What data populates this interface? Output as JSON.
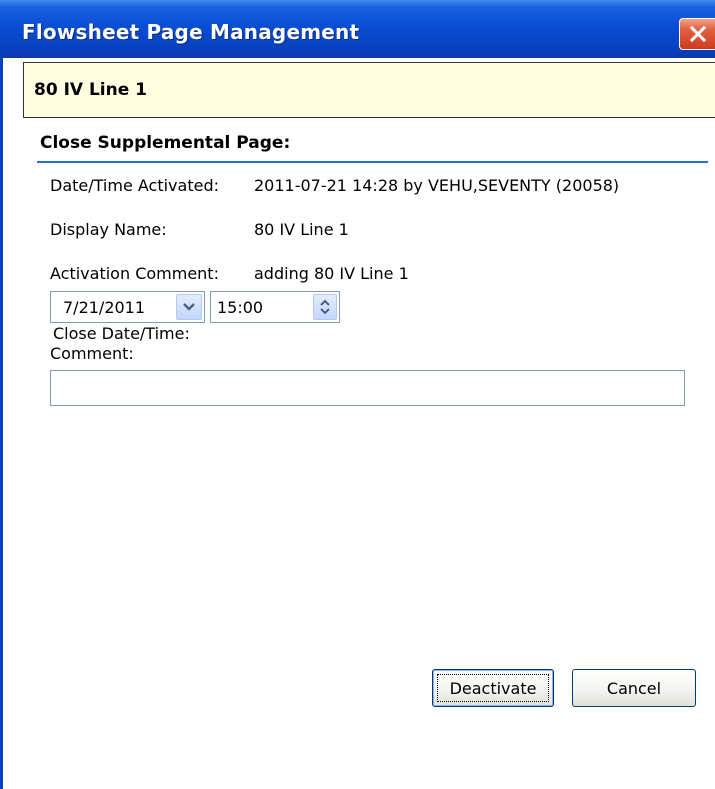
{
  "window": {
    "title": "Flowsheet Page Management"
  },
  "page_header": "80 IV Line 1",
  "section": {
    "title": "Close Supplemental Page:"
  },
  "fields": {
    "date_time_activated": {
      "label": "Date/Time Activated:",
      "value": "2011-07-21 14:28 by VEHU,SEVENTY (20058)"
    },
    "display_name": {
      "label": "Display Name:",
      "value": "80 IV Line 1"
    },
    "activation_comment": {
      "label": "Activation Comment:",
      "value": "adding 80 IV Line 1"
    }
  },
  "close_datetime": {
    "label": "Close Date/Time:",
    "date": "7/21/2011",
    "time": "15:00"
  },
  "comment": {
    "label": "Comment:",
    "value": ""
  },
  "buttons": {
    "deactivate": "Deactivate",
    "cancel": "Cancel"
  },
  "icons": {
    "close": "close-icon",
    "dropdown": "chevron-down-icon",
    "spinner": "spin-up-down-icon"
  },
  "colors": {
    "titlebar": "#0a4fd6",
    "header_background": "#ffffe1",
    "section_rule": "#2a6fd6",
    "close_button": "#cd3b1d"
  }
}
